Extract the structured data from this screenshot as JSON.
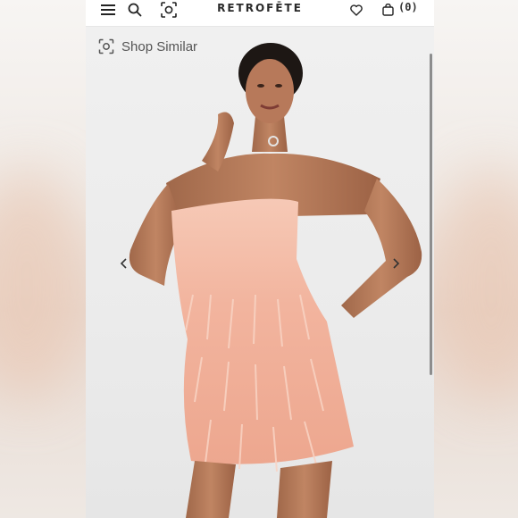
{
  "header": {
    "brand": "RETROFĒTE",
    "cart_count": "(0)",
    "icons": [
      "menu-icon",
      "search-icon",
      "visual-search-icon",
      "heart-icon",
      "bag-icon"
    ]
  },
  "photo": {
    "shop_similar_label": "Shop Similar",
    "dress_color": "#f2b49e",
    "background_color": "#ededed"
  },
  "colors": {
    "text": "#2a2a2a",
    "accent": "#f2b49e"
  }
}
